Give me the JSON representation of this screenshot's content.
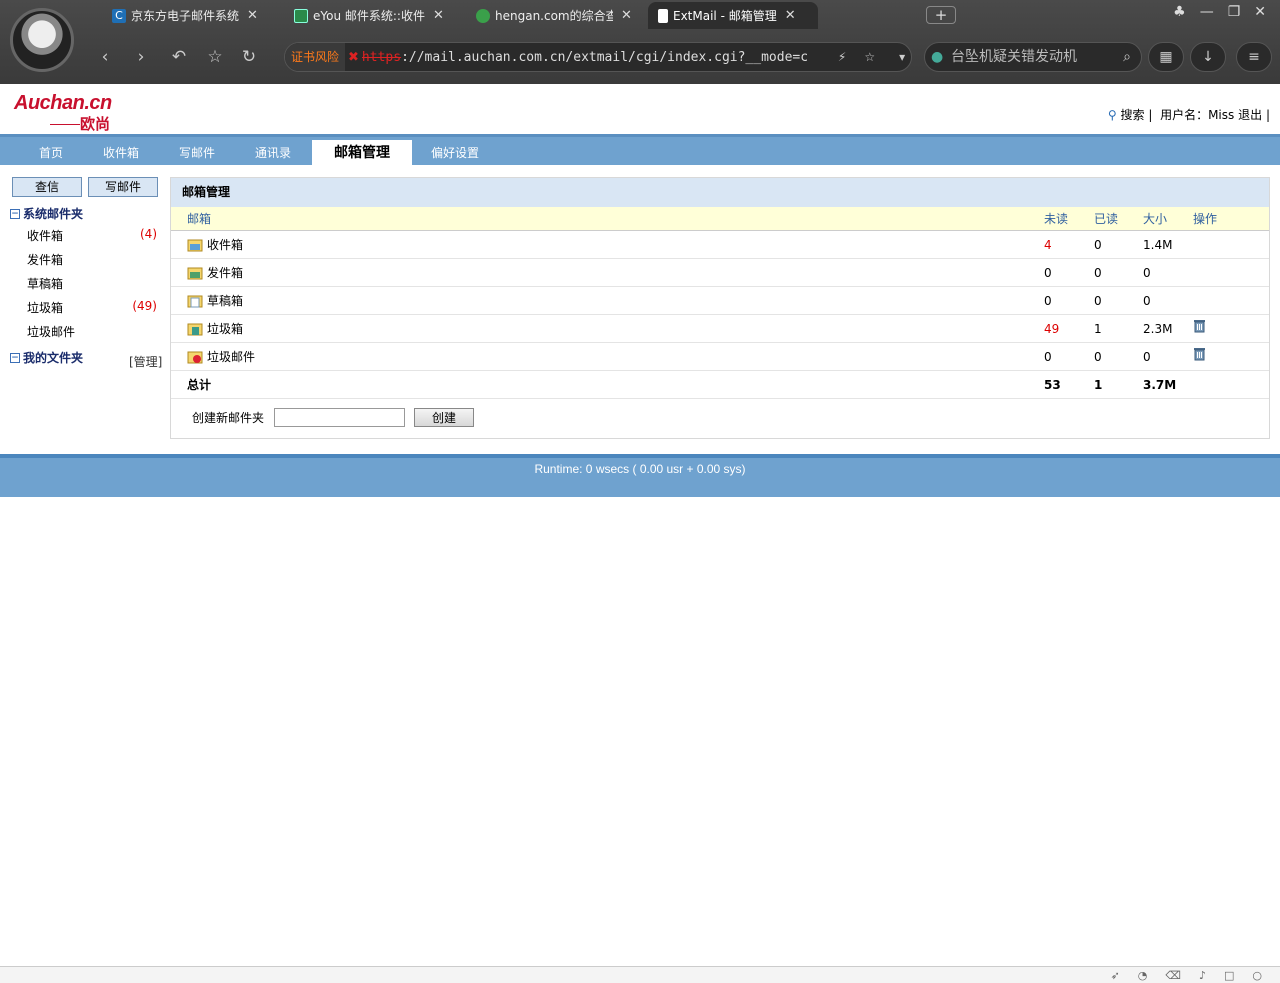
{
  "browser": {
    "tabs": [
      {
        "title": "京东方电子邮件系统",
        "icon": "c-icon",
        "color": "#1f6fb5"
      },
      {
        "title": "eYou 邮件系统::收件",
        "icon": "mail-icon",
        "color": "#2a8a4a"
      },
      {
        "title": "hengan.com的综合查",
        "icon": "globe-icon",
        "color": "#3aa04a"
      },
      {
        "title": "ExtMail - 邮箱管理",
        "icon": "page-icon",
        "color": "#ffffff"
      }
    ],
    "cert_warning": "证书风险",
    "url_proto": "https",
    "url_rest": "://mail.auchan.com.cn/extmail/cgi/index.cgi?__mode=c",
    "search_text": "台坠机疑关错发动机"
  },
  "logo": {
    "brand": "Auchan.cn",
    "chinese": "欧尚"
  },
  "toplinks": {
    "search": "搜索",
    "sep": "|",
    "username_label": "用户名：",
    "username": "Miss",
    "logout": "退出"
  },
  "nav": {
    "tabs": [
      {
        "label": "首页"
      },
      {
        "label": "收件箱"
      },
      {
        "label": "写邮件"
      },
      {
        "label": "通讯录"
      },
      {
        "label": "邮箱管理"
      },
      {
        "label": "偏好设置"
      }
    ]
  },
  "sidebar": {
    "check_button": "查信",
    "compose_button": "写邮件",
    "system_folders": "系统邮件夹",
    "items": [
      {
        "label": "收件箱",
        "count": "(4)"
      },
      {
        "label": "发件箱",
        "count": ""
      },
      {
        "label": "草稿箱",
        "count": ""
      },
      {
        "label": "垃圾箱",
        "count": "(49)"
      },
      {
        "label": "垃圾邮件",
        "count": ""
      }
    ],
    "my_folders": "我的文件夹",
    "manage": "[管理]"
  },
  "main": {
    "title": "邮箱管理",
    "columns": {
      "name": "邮箱",
      "unread": "未读",
      "read": "已读",
      "size": "大小",
      "op": "操作"
    },
    "rows": [
      {
        "name": "收件箱",
        "unread": "4",
        "read": "0",
        "size": "1.4M"
      },
      {
        "name": "发件箱",
        "unread": "0",
        "read": "0",
        "size": "0"
      },
      {
        "name": "草稿箱",
        "unread": "0",
        "read": "0",
        "size": "0"
      },
      {
        "name": "垃圾箱",
        "unread": "49",
        "read": "1",
        "size": "2.3M"
      },
      {
        "name": "垃圾邮件",
        "unread": "0",
        "read": "0",
        "size": "0"
      }
    ],
    "total": {
      "label": "总计",
      "unread": "53",
      "read": "1",
      "size": "3.7M"
    },
    "new_folder_label": "创建新邮件夹",
    "new_folder_value": "",
    "create_button": "创建"
  },
  "footer": {
    "runtime": "Runtime: 0 wsecs ( 0.00 usr + 0.00 sys)"
  }
}
